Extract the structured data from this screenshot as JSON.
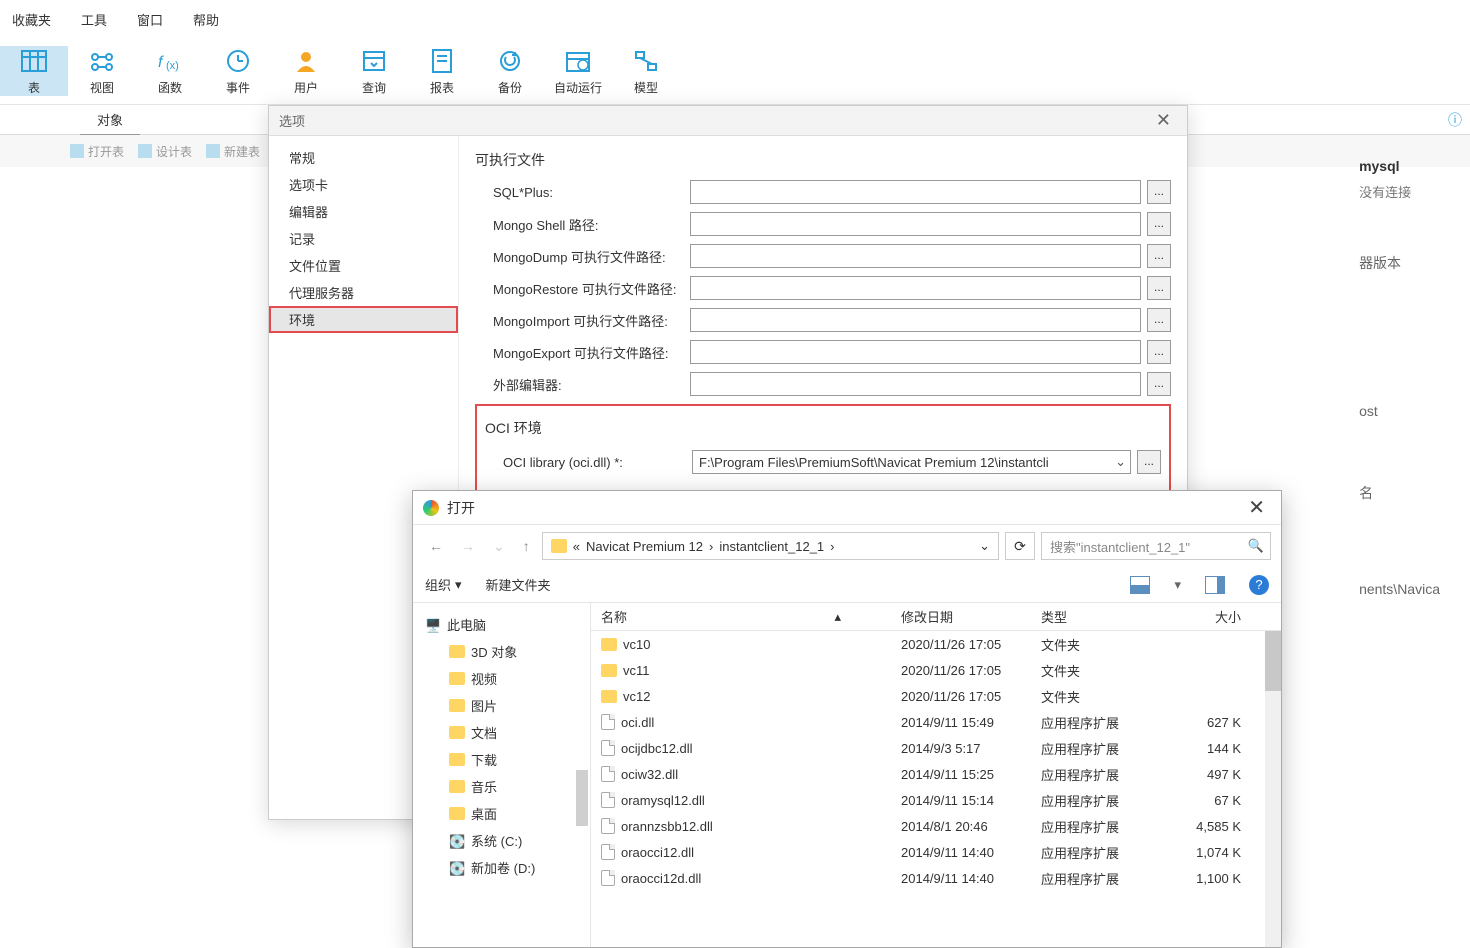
{
  "top_menu": {
    "favorites": "收藏夹",
    "tools": "工具",
    "window": "窗口",
    "help": "帮助"
  },
  "toolbar": {
    "table": "表",
    "view": "视图",
    "function": "函数",
    "event": "事件",
    "user": "用户",
    "query": "查询",
    "report": "报表",
    "backup": "备份",
    "schedule": "自动运行",
    "model": "模型"
  },
  "mid": {
    "object_tab": "对象"
  },
  "sub_toolbar": {
    "open_table": "打开表",
    "design_table": "设计表",
    "new_table": "新建表"
  },
  "right_info": {
    "title": "mysql",
    "sub": "没有连接",
    "server_version": "器版本",
    "host": "ost",
    "name_label": "名",
    "path_fragment": "nents\\Navica"
  },
  "options_dialog": {
    "title": "选项",
    "nav": {
      "general": "常规",
      "tabs": "选项卡",
      "editor": "编辑器",
      "log": "记录",
      "file_location": "文件位置",
      "proxy": "代理服务器",
      "environment": "环境"
    },
    "executable_section": "可执行文件",
    "fields": {
      "sqlplus": "SQL*Plus:",
      "mongo_shell": "Mongo Shell 路径:",
      "mongodump": "MongoDump 可执行文件路径:",
      "mongorestore": "MongoRestore 可执行文件路径:",
      "mongoimport": "MongoImport 可执行文件路径:",
      "mongoexport": "MongoExport 可执行文件路径:",
      "external_editor": "外部编辑器:"
    },
    "oci_section": "OCI 环境",
    "oci_label": "OCI library (oci.dll) *:",
    "oci_value": "F:\\Program Files\\PremiumSoft\\Navicat Premium 12\\instantcli",
    "browse": "..."
  },
  "file_dialog": {
    "title": "打开",
    "breadcrumb": {
      "prefix": "«",
      "p1": "Navicat Premium 12",
      "p2": "instantclient_12_1"
    },
    "search_placeholder": "搜索\"instantclient_12_1\"",
    "organize": "组织",
    "new_folder": "新建文件夹",
    "tree": {
      "this_pc": "此电脑",
      "objects3d": "3D 对象",
      "videos": "视频",
      "pictures": "图片",
      "documents": "文档",
      "downloads": "下载",
      "music": "音乐",
      "desktop": "桌面",
      "system_c": "系统 (C:)",
      "new_vol_d": "新加卷 (D:)"
    },
    "columns": {
      "name": "名称",
      "date": "修改日期",
      "type": "类型",
      "size": "大小"
    },
    "rows": [
      {
        "icon": "folder",
        "name": "vc10",
        "date": "2020/11/26 17:05",
        "type": "文件夹",
        "size": ""
      },
      {
        "icon": "folder",
        "name": "vc11",
        "date": "2020/11/26 17:05",
        "type": "文件夹",
        "size": ""
      },
      {
        "icon": "folder",
        "name": "vc12",
        "date": "2020/11/26 17:05",
        "type": "文件夹",
        "size": ""
      },
      {
        "icon": "file",
        "name": "oci.dll",
        "date": "2014/9/11 15:49",
        "type": "应用程序扩展",
        "size": "627 K"
      },
      {
        "icon": "file",
        "name": "ocijdbc12.dll",
        "date": "2014/9/3 5:17",
        "type": "应用程序扩展",
        "size": "144 K"
      },
      {
        "icon": "file",
        "name": "ociw32.dll",
        "date": "2014/9/11 15:25",
        "type": "应用程序扩展",
        "size": "497 K"
      },
      {
        "icon": "file",
        "name": "oramysql12.dll",
        "date": "2014/9/11 15:14",
        "type": "应用程序扩展",
        "size": "67 K"
      },
      {
        "icon": "file",
        "name": "orannzsbb12.dll",
        "date": "2014/8/1 20:46",
        "type": "应用程序扩展",
        "size": "4,585 K"
      },
      {
        "icon": "file",
        "name": "oraocci12.dll",
        "date": "2014/9/11 14:40",
        "type": "应用程序扩展",
        "size": "1,074 K"
      },
      {
        "icon": "file",
        "name": "oraocci12d.dll",
        "date": "2014/9/11 14:40",
        "type": "应用程序扩展",
        "size": "1,100 K"
      }
    ]
  }
}
